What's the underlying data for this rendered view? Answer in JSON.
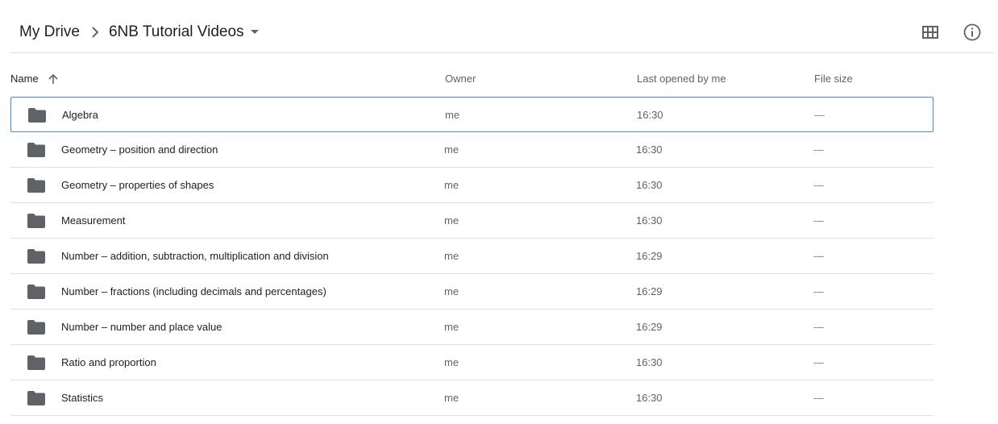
{
  "breadcrumb": {
    "root": "My Drive",
    "separator_icon": "chevron-right-icon",
    "current": "6NB Tutorial Videos",
    "dropdown_icon": "caret-down-icon"
  },
  "header_actions": {
    "grid_view_icon": "grid-view-icon",
    "info_icon": "info-icon"
  },
  "columns": {
    "name": "Name",
    "sort_icon": "arrow-up-icon",
    "owner": "Owner",
    "last_opened": "Last opened by me",
    "file_size": "File size"
  },
  "rows": [
    {
      "name": "Algebra",
      "owner": "me",
      "opened": "16:30",
      "size": "—",
      "selected": true
    },
    {
      "name": "Geometry – position and direction",
      "owner": "me",
      "opened": "16:30",
      "size": "—"
    },
    {
      "name": "Geometry – properties of shapes",
      "owner": "me",
      "opened": "16:30",
      "size": "—"
    },
    {
      "name": "Measurement",
      "owner": "me",
      "opened": "16:30",
      "size": "—"
    },
    {
      "name": "Number – addition, subtraction, multiplication and division",
      "owner": "me",
      "opened": "16:29",
      "size": "—"
    },
    {
      "name": "Number – fractions (including decimals and percentages)",
      "owner": "me",
      "opened": "16:29",
      "size": "—"
    },
    {
      "name": "Number – number and place value",
      "owner": "me",
      "opened": "16:29",
      "size": "—"
    },
    {
      "name": "Ratio and proportion",
      "owner": "me",
      "opened": "16:30",
      "size": "—"
    },
    {
      "name": "Statistics",
      "owner": "me",
      "opened": "16:30",
      "size": "—"
    }
  ],
  "colors": {
    "folder": "#5f6368",
    "selection_border": "#4285f4",
    "divider": "#e0e0e0"
  }
}
